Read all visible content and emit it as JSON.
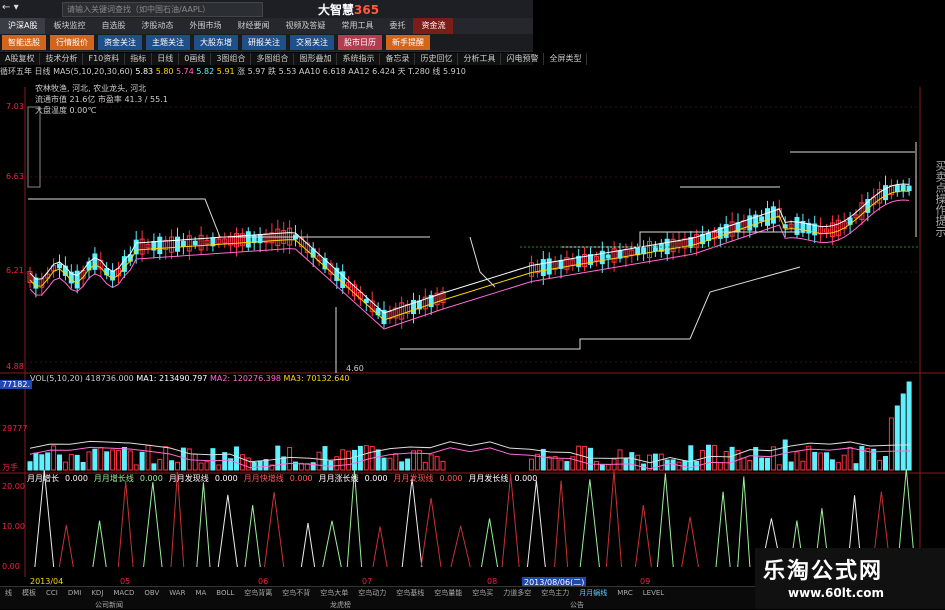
{
  "app": {
    "title_main": "大智慧",
    "title_suffix": "365",
    "search_placeholder": "请输入关键词查找（如中国石油/AAPL）",
    "nav_back": "←",
    "nav_dropdown": "▾"
  },
  "menu": [
    "沪深A股",
    "板块监控",
    "自选股",
    "涉股动态",
    "外围市场",
    "财经要闻",
    "视频及答疑",
    "常用工具",
    "委托",
    "资金流"
  ],
  "menu_highlight_index": 0,
  "menu_red_index": 9,
  "tabs": [
    {
      "label": "智能选股",
      "style": "orange"
    },
    {
      "label": "行情报价",
      "style": "orange"
    },
    {
      "label": "资金关注",
      "style": "blue"
    },
    {
      "label": "主题关注",
      "style": "blue"
    },
    {
      "label": "大股东增",
      "style": "blue"
    },
    {
      "label": "研报关注",
      "style": "blue"
    },
    {
      "label": "交易关注",
      "style": "blue"
    },
    {
      "label": "股市日历",
      "style": "pink"
    },
    {
      "label": "新手提醒",
      "style": "orange"
    }
  ],
  "toolbar": [
    "A股复权",
    "技术分析",
    "F10资料",
    "指标",
    "日线",
    "0画线",
    "3图组合",
    "多图组合",
    "图形叠加",
    "系统指示",
    "备忘录",
    "历史回忆",
    "分析工具",
    "闪电预警",
    "全屏类型"
  ],
  "ma_line": {
    "name": "循环五年 日线",
    "ma_label": "MA5(5,10,20,30,60)",
    "values": [
      "5.83",
      "5.80",
      "5.74",
      "5.82",
      "5.91"
    ],
    "extra": "涨 5.97 跌 5.53 AA10 6.618 AA12 6.424 天 T.280 线 5.910"
  },
  "info_box": [
    "农林牧渔, 河北, 农业龙头, 河北",
    "流通市值 21.6亿   市盈率 41.3 / 55.1",
    "大盘温度 0.00℃"
  ],
  "price_axis": [
    "7.03",
    "6.63",
    "6.21",
    "4.88"
  ],
  "chart_labels": {
    "low_mark": "4.60",
    "buy_labels": [
      "金钻",
      "金钻",
      "金钻",
      "金钻",
      "金钻",
      "金钻"
    ],
    "buy_label_special": "买中买"
  },
  "volume_line": {
    "label": "VOL(5,10,20)",
    "v1": "418736.000",
    "ma1": "MA1: 213490.797",
    "ma2": "MA2: 120276.398",
    "ma3": "MA3: 70132.640",
    "axis_top": "77182.",
    "axis_mid": "29777",
    "axis_low": "万手"
  },
  "indicator_line": [
    {
      "label": "月月增长",
      "value": "0.000"
    },
    {
      "label": "月月增长线",
      "value": "0.000"
    },
    {
      "label": "月月发现线",
      "value": "0.000"
    },
    {
      "label": "月月快增线",
      "value": "0.000"
    },
    {
      "label": "月月涨长线",
      "value": "0.000"
    },
    {
      "label": "月月发现线",
      "value": "0.000"
    },
    {
      "label": "月月发长线",
      "value": "0.000"
    }
  ],
  "indicator_axis": [
    "20.00",
    "10.00",
    "0.00"
  ],
  "date_bar": {
    "start": "2013/04",
    "m1": "05",
    "m2": "06",
    "m3": "07",
    "m4": "08",
    "m5": "09",
    "selected": "2013/08/06(二)",
    "m6": "10",
    "m7": "11"
  },
  "bottom_tabs": [
    "线",
    "模板",
    "CCI",
    "DMI",
    "KDJ",
    "MACD",
    "OBV",
    "WAR",
    "MA",
    "BOLL",
    "空鸟背离",
    "空鸟不背",
    "空鸟大单",
    "空鸟动力",
    "空鸟基线",
    "空鸟量能",
    "空鸟买",
    "力道多空",
    "空鸟主力",
    "月月蜗线",
    "MRC",
    "LEVEL"
  ],
  "bottom_selected_index": 19,
  "status_bar": [
    "公司新闻",
    "龙虎榜",
    "公告"
  ],
  "right_text": "买卖点操作提示",
  "watermark": {
    "line1": "乐淘公式网",
    "line2": "www.60lt.com"
  },
  "chart_data": {
    "type": "candlestick",
    "price_axis": [
      "7.03",
      "6.63",
      "6.21",
      "4.88"
    ],
    "low_label": "4.60",
    "ma_values": [
      "5.83",
      "5.80",
      "5.74",
      "5.82",
      "5.91"
    ],
    "volume_axis": [
      "77182.",
      "29777",
      "万手"
    ],
    "indicator_axis": [
      "20.00",
      "10.00",
      "0.00"
    ],
    "x_axis_months": [
      "2013/04",
      "05",
      "06",
      "07",
      "08",
      "09",
      "10",
      "11"
    ],
    "colors": {
      "up": "#ff3344",
      "down": "#5ef0ff",
      "ma1": "#ffffff",
      "ma2": "#ffd700",
      "ma3": "#ff6ad5",
      "ind_green": "#9cf09c",
      "ind_white": "#eeeeee",
      "ind_red": "#c83232"
    }
  }
}
